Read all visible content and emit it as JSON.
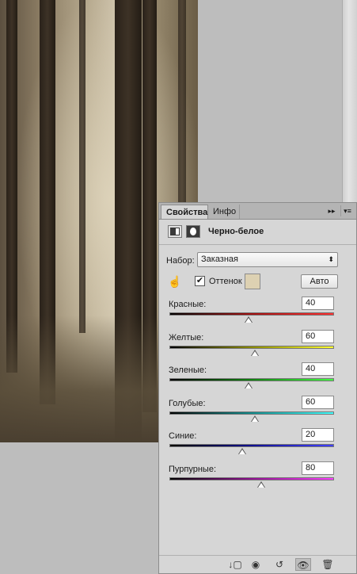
{
  "tabs": {
    "properties": "Свойства",
    "info": "Инфо"
  },
  "panel_menu": {
    "collapse": "▸▸",
    "menu": "▾≡"
  },
  "adjustment": {
    "title": "Черно-белое"
  },
  "preset": {
    "label": "Набор:",
    "value": "Заказная",
    "arrows": "⬍"
  },
  "tint": {
    "label": "Оттенок",
    "checked": true,
    "check_glyph": "✔",
    "swatch_color": "#ddd1b2"
  },
  "auto_button": "Авто",
  "targeted_adjust_glyph": "☝",
  "sliders": [
    {
      "label": "Красные:",
      "value": "40",
      "gradient": [
        "#000000",
        "#a01010",
        "#ff3030"
      ]
    },
    {
      "label": "Желтые:",
      "value": "60",
      "gradient": [
        "#000000",
        "#8a8a00",
        "#ffff30"
      ]
    },
    {
      "label": "Зеленые:",
      "value": "40",
      "gradient": [
        "#000000",
        "#108010",
        "#40ff40"
      ]
    },
    {
      "label": "Голубые:",
      "value": "60",
      "gradient": [
        "#000000",
        "#108a8a",
        "#40ffff"
      ]
    },
    {
      "label": "Синие:",
      "value": "20",
      "gradient": [
        "#000000",
        "#101090",
        "#4040ff"
      ]
    },
    {
      "label": "Пурпурные:",
      "value": "80",
      "gradient": [
        "#000000",
        "#901090",
        "#ff40ff"
      ]
    }
  ],
  "slider_range": {
    "min": -200,
    "max": 300
  },
  "footer_icons": {
    "clip": "↓▢",
    "view_previous": "◉",
    "reset": "↺",
    "visibility": "👁",
    "delete": "🗑"
  }
}
